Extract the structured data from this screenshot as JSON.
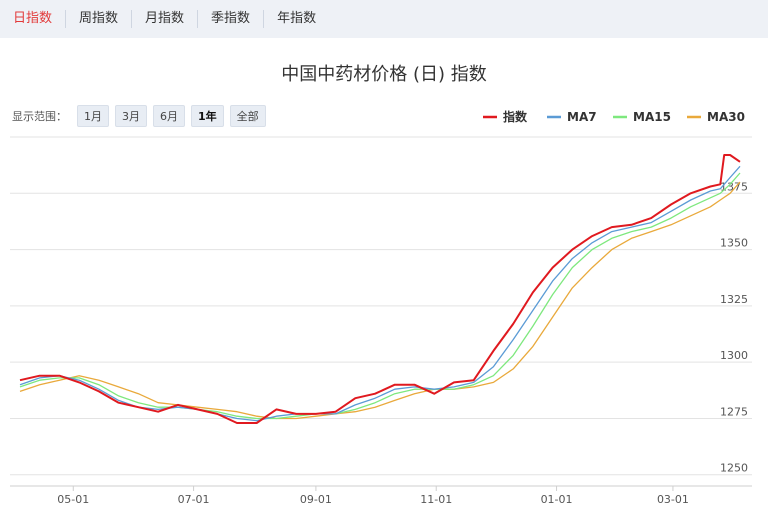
{
  "tabs": [
    {
      "label": "日指数",
      "active": true
    },
    {
      "label": "周指数",
      "active": false
    },
    {
      "label": "月指数",
      "active": false
    },
    {
      "label": "季指数",
      "active": false
    },
    {
      "label": "年指数",
      "active": false
    }
  ],
  "range_label": "显示范围：",
  "range_buttons": [
    {
      "label": "1月",
      "active": false
    },
    {
      "label": "3月",
      "active": false
    },
    {
      "label": "6月",
      "active": false
    },
    {
      "label": "1年",
      "active": true
    },
    {
      "label": "全部",
      "active": false
    }
  ],
  "chart_data": {
    "type": "line",
    "title": "中国中药材价格 (日) 指数",
    "xlabel": "",
    "ylabel": "",
    "ylim": [
      1245,
      1400
    ],
    "x_ticks": [
      "05-01",
      "07-01",
      "09-01",
      "11-01",
      "01-01",
      "03-01"
    ],
    "y_ticks": [
      1250,
      1275,
      1300,
      1325,
      1350,
      1375
    ],
    "grid": true,
    "legend_position": "top-right",
    "series": [
      {
        "name": "指数",
        "color": "#e0191f",
        "x": [
          0,
          10,
          20,
          30,
          40,
          50,
          60,
          70,
          80,
          90,
          100,
          110,
          120,
          130,
          140,
          150,
          160,
          170,
          180,
          190,
          200,
          210,
          220,
          230,
          240,
          250,
          260,
          270,
          280,
          290,
          300,
          310,
          320,
          330,
          340,
          350,
          355,
          357,
          360,
          365
        ],
        "values": [
          1292,
          1294,
          1294,
          1291,
          1287,
          1282,
          1280,
          1278,
          1281,
          1279,
          1277,
          1273,
          1273,
          1279,
          1277,
          1277,
          1278,
          1284,
          1286,
          1290,
          1290,
          1286,
          1291,
          1292,
          1305,
          1317,
          1331,
          1342,
          1350,
          1356,
          1360,
          1361,
          1364,
          1370,
          1375,
          1378,
          1379,
          1392,
          1392,
          1389
        ]
      },
      {
        "name": "MA7",
        "color": "#5b9bd5",
        "x": [
          0,
          10,
          20,
          30,
          40,
          50,
          60,
          70,
          80,
          90,
          100,
          110,
          120,
          130,
          140,
          150,
          160,
          170,
          180,
          190,
          200,
          210,
          220,
          230,
          240,
          250,
          260,
          270,
          280,
          290,
          300,
          310,
          320,
          330,
          340,
          350,
          355,
          360,
          365
        ],
        "values": [
          1290,
          1293,
          1294,
          1292,
          1288,
          1283,
          1280,
          1279,
          1280,
          1279,
          1277,
          1275,
          1274,
          1276,
          1277,
          1277,
          1277,
          1281,
          1284,
          1288,
          1289,
          1288,
          1289,
          1291,
          1298,
          1310,
          1323,
          1336,
          1346,
          1353,
          1358,
          1360,
          1362,
          1367,
          1372,
          1376,
          1377,
          1382,
          1387
        ]
      },
      {
        "name": "MA15",
        "color": "#7ee87e",
        "x": [
          0,
          10,
          20,
          30,
          40,
          50,
          60,
          70,
          80,
          90,
          100,
          110,
          120,
          130,
          140,
          150,
          160,
          170,
          180,
          190,
          200,
          210,
          220,
          230,
          240,
          250,
          260,
          270,
          280,
          290,
          300,
          310,
          320,
          330,
          340,
          350,
          355,
          360,
          365
        ],
        "values": [
          1289,
          1292,
          1293,
          1293,
          1290,
          1285,
          1282,
          1280,
          1280,
          1279,
          1278,
          1276,
          1275,
          1275,
          1276,
          1277,
          1277,
          1279,
          1282,
          1286,
          1288,
          1288,
          1288,
          1290,
          1294,
          1303,
          1316,
          1330,
          1342,
          1350,
          1355,
          1358,
          1360,
          1364,
          1369,
          1373,
          1375,
          1379,
          1384
        ]
      },
      {
        "name": "MA30",
        "color": "#e9a93b",
        "x": [
          0,
          10,
          20,
          30,
          40,
          50,
          60,
          70,
          80,
          90,
          100,
          110,
          120,
          130,
          140,
          150,
          160,
          170,
          180,
          190,
          200,
          210,
          220,
          230,
          240,
          250,
          260,
          270,
          280,
          290,
          300,
          310,
          320,
          330,
          340,
          350,
          355,
          360,
          365
        ],
        "values": [
          1287,
          1290,
          1292,
          1294,
          1292,
          1289,
          1286,
          1282,
          1281,
          1280,
          1279,
          1278,
          1276,
          1275,
          1275,
          1276,
          1277,
          1278,
          1280,
          1283,
          1286,
          1288,
          1288,
          1289,
          1291,
          1297,
          1307,
          1320,
          1333,
          1342,
          1350,
          1355,
          1358,
          1361,
          1365,
          1369,
          1372,
          1375,
          1380
        ]
      }
    ]
  }
}
